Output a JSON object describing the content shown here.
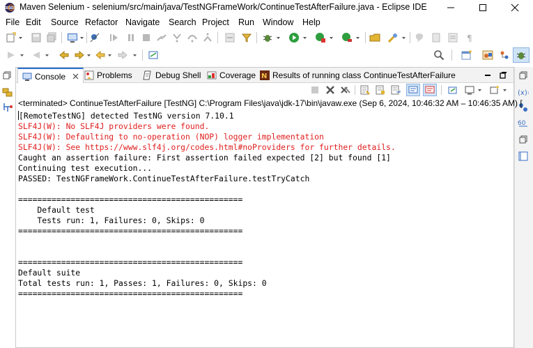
{
  "window": {
    "title": "Maven Selenium - selenium/src/main/java/TestNGFrameWork/ContinueTestAfterFailure.java - Eclipse IDE",
    "minimize_icon": "minimize-icon",
    "maximize_icon": "maximize-icon",
    "close_icon": "close-icon"
  },
  "menu": [
    "File",
    "Edit",
    "Source",
    "Refactor",
    "Navigate",
    "Search",
    "Project",
    "Run",
    "Window",
    "Help"
  ],
  "tabs": [
    {
      "label": "Console",
      "icon": "console-icon",
      "active": true
    },
    {
      "label": "Problems",
      "icon": "problems-icon"
    },
    {
      "label": "Debug Shell",
      "icon": "debug-shell-icon"
    },
    {
      "label": "Coverage",
      "icon": "coverage-icon"
    },
    {
      "label": "Results of running class ContinueTestAfterFailure",
      "icon": "testng-icon"
    }
  ],
  "terminated_text": "<terminated> ContinueTestAfterFailure [TestNG] C:\\Program Files\\java\\jdk-17\\bin\\javaw.exe  (Sep 6, 2024, 10:46:32 AM – 10:46:35 AM) [",
  "console_lines": [
    {
      "text": "[RemoteTestNG] detected TestNG version 7.10.1",
      "kind": "out"
    },
    {
      "text": "SLF4J(W): No SLF4J providers were found.",
      "kind": "err"
    },
    {
      "text": "SLF4J(W): Defaulting to no-operation (NOP) logger implementation",
      "kind": "err"
    },
    {
      "text": "SLF4J(W): See https://www.slf4j.org/codes.html#noProviders for further details.",
      "kind": "err"
    },
    {
      "text": "Caught an assertion failure: First assertion failed expected [2] but found [1]",
      "kind": "out"
    },
    {
      "text": "Continuing test execution...",
      "kind": "out"
    },
    {
      "text": "PASSED: TestNGFrameWork.ContinueTestAfterFailure.testTryCatch",
      "kind": "out"
    },
    {
      "text": "",
      "kind": "out"
    },
    {
      "text": "===============================================",
      "kind": "out"
    },
    {
      "text": "    Default test",
      "kind": "out"
    },
    {
      "text": "    Tests run: 1, Failures: 0, Skips: 0",
      "kind": "out"
    },
    {
      "text": "===============================================",
      "kind": "out"
    },
    {
      "text": "",
      "kind": "out"
    },
    {
      "text": "",
      "kind": "out"
    },
    {
      "text": "===============================================",
      "kind": "out"
    },
    {
      "text": "Default suite",
      "kind": "out"
    },
    {
      "text": "Total tests run: 1, Passes: 1, Failures: 0, Skips: 0",
      "kind": "out"
    },
    {
      "text": "===============================================",
      "kind": "out"
    }
  ],
  "colors": {
    "error_text": "#e01e1e",
    "accent": "#2a6fcf"
  }
}
